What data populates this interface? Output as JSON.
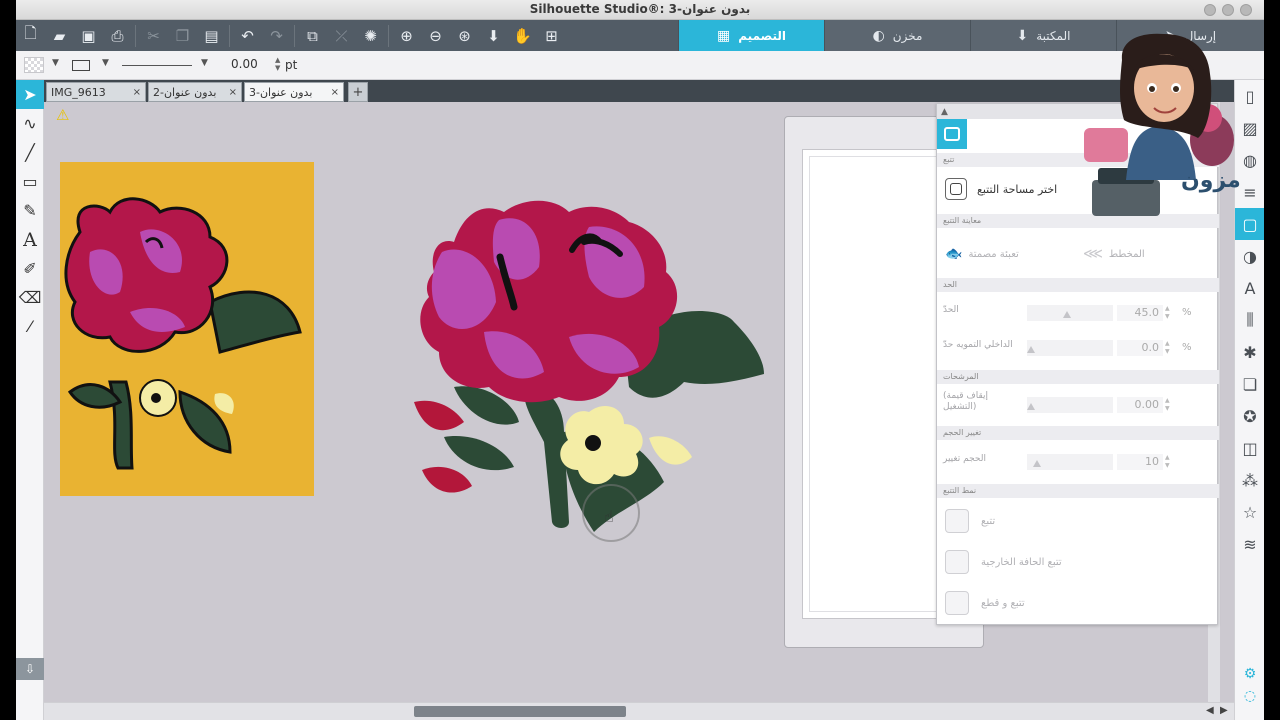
{
  "window": {
    "title": "Silhouette Studio®: بدون عنوان-3"
  },
  "toolbar": {
    "tabs": [
      {
        "label": "التصميم",
        "icon": "grid-icon",
        "active": true
      },
      {
        "label": "مخزن",
        "icon": "store-icon",
        "active": false
      },
      {
        "label": "المكتبة",
        "icon": "library-icon",
        "active": false
      },
      {
        "label": "إرسال",
        "icon": "send-icon",
        "active": false
      }
    ],
    "icons": [
      "new-file-icon",
      "open-folder-icon",
      "save-icon",
      "print-icon",
      "cut-icon",
      "copy-icon",
      "paste-icon",
      "undo-icon",
      "redo-icon",
      "group-icon",
      "ungroup-icon",
      "select-all-icon",
      "zoom-in-icon",
      "zoom-out-icon",
      "zoom-fit-icon",
      "move-down-icon",
      "pan-hand-icon",
      "zoom-region-icon"
    ]
  },
  "options": {
    "line_weight": "0.00",
    "line_unit": "pt"
  },
  "document_tabs": [
    {
      "label": "IMG_9613",
      "close": "×",
      "active": false
    },
    {
      "label": "بدون عنوان-2",
      "close": "×",
      "active": false
    },
    {
      "label": "بدون عنوان-3",
      "close": "×",
      "active": true
    }
  ],
  "add_tab": "+",
  "trace_panel": {
    "section_trace": "تتبع",
    "select_area": "اختر مساحة التتبع",
    "section_preview": "معاينة التتبع",
    "preview_solid": "تعبئة مصمتة",
    "preview_outline": "المخطط",
    "section_threshold": "الحد",
    "threshold_label": "الحدّ",
    "threshold_value": "45.0",
    "threshold_unit": "%",
    "blur_label": "الداخلي التمويه حدّ",
    "blur_value": "0.0",
    "blur_unit": "%",
    "section_filters": "المرشحات",
    "highpass_label": "(إيقاف قيمة التشغيل)",
    "highpass_value": "0.00",
    "section_scale": "تغيير الحجم",
    "scale_label": "الحجم تغيير",
    "scale_value": "10",
    "section_style": "نمط التتبع",
    "btn_trace": "تتبع",
    "btn_outer": "تتبع الحافة الخارجية",
    "btn_trace_detach": "تتبع و قطع"
  },
  "watermark": {
    "text": "مزون"
  },
  "colors": {
    "accent": "#2bb6d9",
    "toolbar": "#525c66",
    "canvas": "#ccc9d0",
    "photo_bg": "#e9b332"
  }
}
